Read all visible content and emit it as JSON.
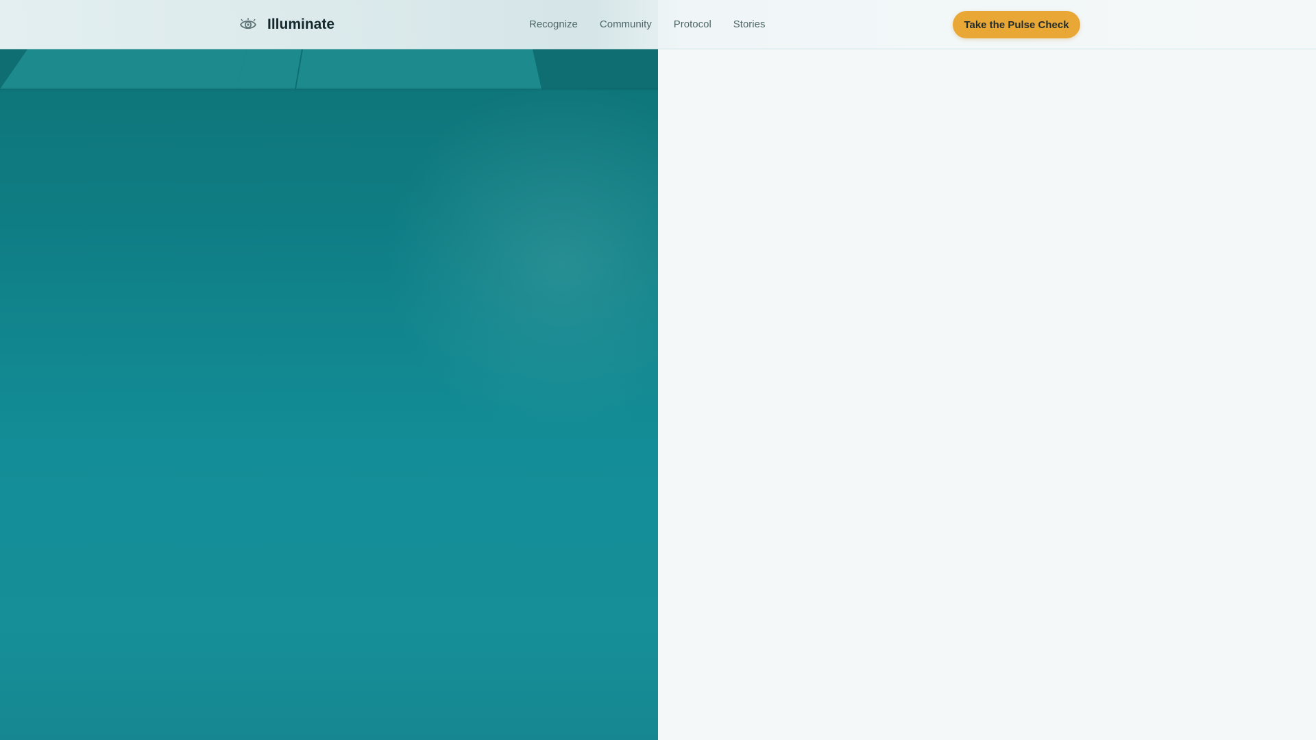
{
  "header": {
    "brand": {
      "name": "Illuminate",
      "icon": "eye-icon"
    },
    "nav": [
      {
        "label": "Recognize"
      },
      {
        "label": "Community"
      },
      {
        "label": "Protocol"
      },
      {
        "label": "Stories"
      }
    ],
    "cta": {
      "label": "Take the Pulse Check"
    }
  },
  "colors": {
    "accent": "#e9a736",
    "hero_teal": "#138d97",
    "background": "#f4f8f9",
    "text_dark": "#12282c",
    "nav_text": "#4f6669"
  }
}
